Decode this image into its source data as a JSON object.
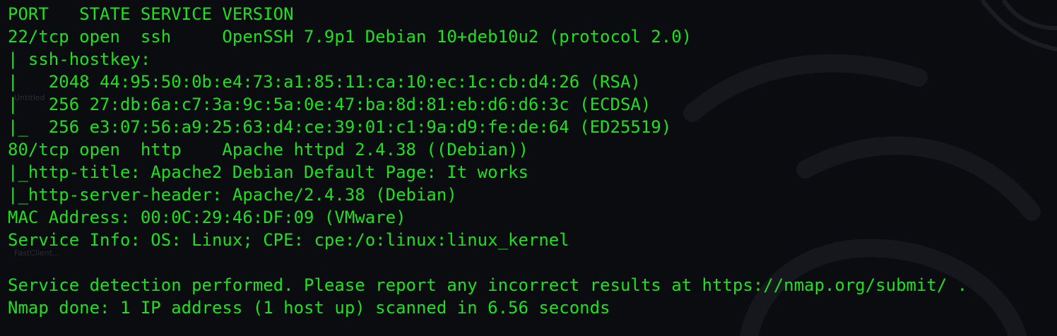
{
  "background_labels": {
    "desktop_label_1": "Untitled",
    "desktop_label_2": "FastClient..."
  },
  "colors": {
    "background": "#0b0c10",
    "text": "#1fe01f"
  },
  "terminal": {
    "lines": [
      "PORT   STATE SERVICE VERSION",
      "22/tcp open  ssh     OpenSSH 7.9p1 Debian 10+deb10u2 (protocol 2.0)",
      "| ssh-hostkey: ",
      "|   2048 44:95:50:0b:e4:73:a1:85:11:ca:10:ec:1c:cb:d4:26 (RSA)",
      "|   256 27:db:6a:c7:3a:9c:5a:0e:47:ba:8d:81:eb:d6:d6:3c (ECDSA)",
      "|_  256 e3:07:56:a9:25:63:d4:ce:39:01:c1:9a:d9:fe:de:64 (ED25519)",
      "80/tcp open  http    Apache httpd 2.4.38 ((Debian))",
      "|_http-title: Apache2 Debian Default Page: It works",
      "|_http-server-header: Apache/2.4.38 (Debian)",
      "MAC Address: 00:0C:29:46:DF:09 (VMware)",
      "Service Info: OS: Linux; CPE: cpe:/o:linux:linux_kernel",
      "",
      "Service detection performed. Please report any incorrect results at https://nmap.org/submit/ .",
      "Nmap done: 1 IP address (1 host up) scanned in 6.56 seconds"
    ]
  }
}
